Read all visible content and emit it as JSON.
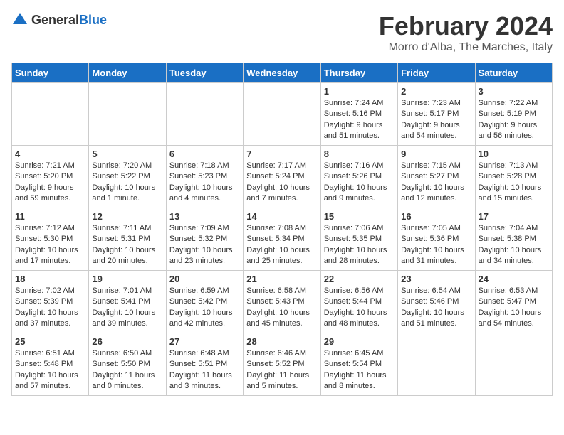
{
  "header": {
    "logo_general": "General",
    "logo_blue": "Blue",
    "title": "February 2024",
    "subtitle": "Morro d'Alba, The Marches, Italy"
  },
  "weekdays": [
    "Sunday",
    "Monday",
    "Tuesday",
    "Wednesday",
    "Thursday",
    "Friday",
    "Saturday"
  ],
  "weeks": [
    [
      {
        "day": "",
        "info": ""
      },
      {
        "day": "",
        "info": ""
      },
      {
        "day": "",
        "info": ""
      },
      {
        "day": "",
        "info": ""
      },
      {
        "day": "1",
        "info": "Sunrise: 7:24 AM\nSunset: 5:16 PM\nDaylight: 9 hours\nand 51 minutes."
      },
      {
        "day": "2",
        "info": "Sunrise: 7:23 AM\nSunset: 5:17 PM\nDaylight: 9 hours\nand 54 minutes."
      },
      {
        "day": "3",
        "info": "Sunrise: 7:22 AM\nSunset: 5:19 PM\nDaylight: 9 hours\nand 56 minutes."
      }
    ],
    [
      {
        "day": "4",
        "info": "Sunrise: 7:21 AM\nSunset: 5:20 PM\nDaylight: 9 hours\nand 59 minutes."
      },
      {
        "day": "5",
        "info": "Sunrise: 7:20 AM\nSunset: 5:22 PM\nDaylight: 10 hours\nand 1 minute."
      },
      {
        "day": "6",
        "info": "Sunrise: 7:18 AM\nSunset: 5:23 PM\nDaylight: 10 hours\nand 4 minutes."
      },
      {
        "day": "7",
        "info": "Sunrise: 7:17 AM\nSunset: 5:24 PM\nDaylight: 10 hours\nand 7 minutes."
      },
      {
        "day": "8",
        "info": "Sunrise: 7:16 AM\nSunset: 5:26 PM\nDaylight: 10 hours\nand 9 minutes."
      },
      {
        "day": "9",
        "info": "Sunrise: 7:15 AM\nSunset: 5:27 PM\nDaylight: 10 hours\nand 12 minutes."
      },
      {
        "day": "10",
        "info": "Sunrise: 7:13 AM\nSunset: 5:28 PM\nDaylight: 10 hours\nand 15 minutes."
      }
    ],
    [
      {
        "day": "11",
        "info": "Sunrise: 7:12 AM\nSunset: 5:30 PM\nDaylight: 10 hours\nand 17 minutes."
      },
      {
        "day": "12",
        "info": "Sunrise: 7:11 AM\nSunset: 5:31 PM\nDaylight: 10 hours\nand 20 minutes."
      },
      {
        "day": "13",
        "info": "Sunrise: 7:09 AM\nSunset: 5:32 PM\nDaylight: 10 hours\nand 23 minutes."
      },
      {
        "day": "14",
        "info": "Sunrise: 7:08 AM\nSunset: 5:34 PM\nDaylight: 10 hours\nand 25 minutes."
      },
      {
        "day": "15",
        "info": "Sunrise: 7:06 AM\nSunset: 5:35 PM\nDaylight: 10 hours\nand 28 minutes."
      },
      {
        "day": "16",
        "info": "Sunrise: 7:05 AM\nSunset: 5:36 PM\nDaylight: 10 hours\nand 31 minutes."
      },
      {
        "day": "17",
        "info": "Sunrise: 7:04 AM\nSunset: 5:38 PM\nDaylight: 10 hours\nand 34 minutes."
      }
    ],
    [
      {
        "day": "18",
        "info": "Sunrise: 7:02 AM\nSunset: 5:39 PM\nDaylight: 10 hours\nand 37 minutes."
      },
      {
        "day": "19",
        "info": "Sunrise: 7:01 AM\nSunset: 5:41 PM\nDaylight: 10 hours\nand 39 minutes."
      },
      {
        "day": "20",
        "info": "Sunrise: 6:59 AM\nSunset: 5:42 PM\nDaylight: 10 hours\nand 42 minutes."
      },
      {
        "day": "21",
        "info": "Sunrise: 6:58 AM\nSunset: 5:43 PM\nDaylight: 10 hours\nand 45 minutes."
      },
      {
        "day": "22",
        "info": "Sunrise: 6:56 AM\nSunset: 5:44 PM\nDaylight: 10 hours\nand 48 minutes."
      },
      {
        "day": "23",
        "info": "Sunrise: 6:54 AM\nSunset: 5:46 PM\nDaylight: 10 hours\nand 51 minutes."
      },
      {
        "day": "24",
        "info": "Sunrise: 6:53 AM\nSunset: 5:47 PM\nDaylight: 10 hours\nand 54 minutes."
      }
    ],
    [
      {
        "day": "25",
        "info": "Sunrise: 6:51 AM\nSunset: 5:48 PM\nDaylight: 10 hours\nand 57 minutes."
      },
      {
        "day": "26",
        "info": "Sunrise: 6:50 AM\nSunset: 5:50 PM\nDaylight: 11 hours\nand 0 minutes."
      },
      {
        "day": "27",
        "info": "Sunrise: 6:48 AM\nSunset: 5:51 PM\nDaylight: 11 hours\nand 3 minutes."
      },
      {
        "day": "28",
        "info": "Sunrise: 6:46 AM\nSunset: 5:52 PM\nDaylight: 11 hours\nand 5 minutes."
      },
      {
        "day": "29",
        "info": "Sunrise: 6:45 AM\nSunset: 5:54 PM\nDaylight: 11 hours\nand 8 minutes."
      },
      {
        "day": "",
        "info": ""
      },
      {
        "day": "",
        "info": ""
      }
    ]
  ]
}
